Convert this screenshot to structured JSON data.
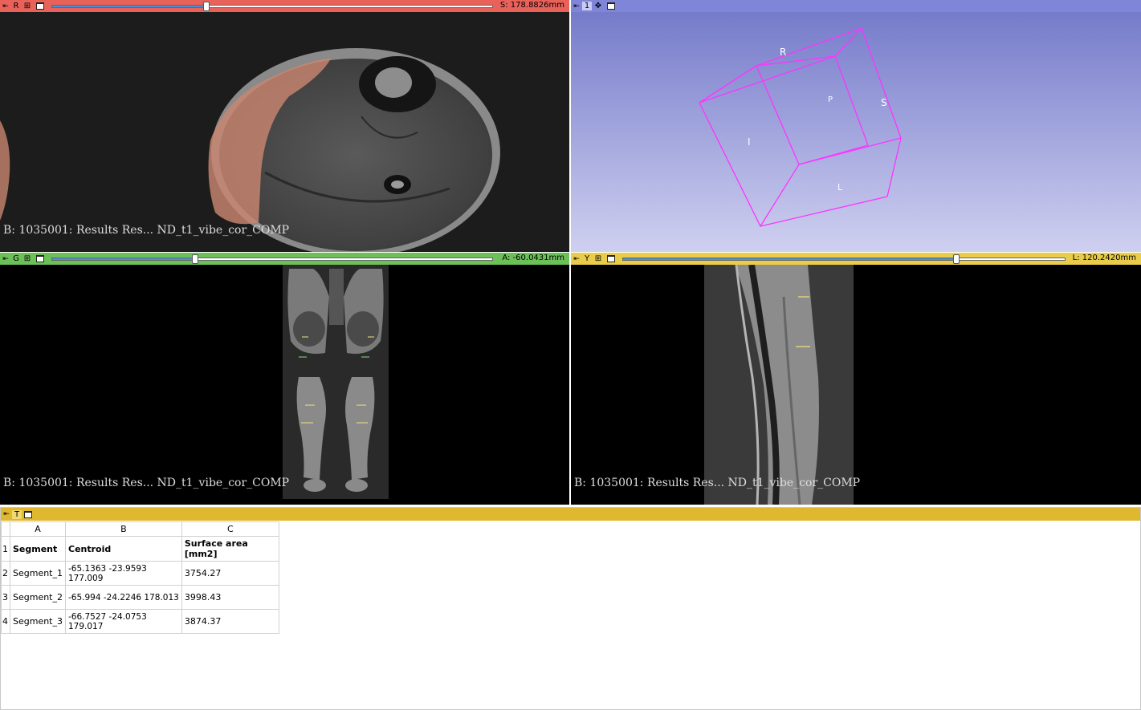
{
  "views": {
    "red": {
      "tag": "R",
      "value": "S: 178.8826mm",
      "slider_pct": 0.31,
      "caption": "B: 1035001: Results Res... ND_t1_vibe_cor_COMP",
      "color": "#e8625a"
    },
    "threed": {
      "tag": "1",
      "labels": {
        "R": "R",
        "P": "P",
        "S": "S",
        "I": "I",
        "L": "L"
      },
      "color": "#7f85d8"
    },
    "green": {
      "tag": "G",
      "value": "A: -60.0431mm",
      "slider_pct": 0.32,
      "caption": "B: 1035001: Results Res... ND_t1_vibe_cor_COMP",
      "color": "#6cc058"
    },
    "yellow": {
      "tag": "Y",
      "value": "L: 120.2420mm",
      "slider_pct": 0.75,
      "caption": "B: 1035001: Results Res... ND_t1_vibe_cor_COMP",
      "color": "#e9cd4a"
    }
  },
  "table_view": {
    "tag": "T",
    "columns": [
      "A",
      "B",
      "C"
    ],
    "row_numbers": [
      "1",
      "2",
      "3",
      "4"
    ],
    "header": [
      "Segment",
      "Centroid",
      "Surface area [mm2]"
    ],
    "rows": [
      [
        "Segment_1",
        "-65.1363 -23.9593 177.009",
        "3754.27"
      ],
      [
        "Segment_2",
        "-65.994 -24.2246 178.013",
        "3998.43"
      ],
      [
        "Segment_3",
        "-66.7527 -24.0753 179.017",
        "3874.37"
      ]
    ]
  }
}
